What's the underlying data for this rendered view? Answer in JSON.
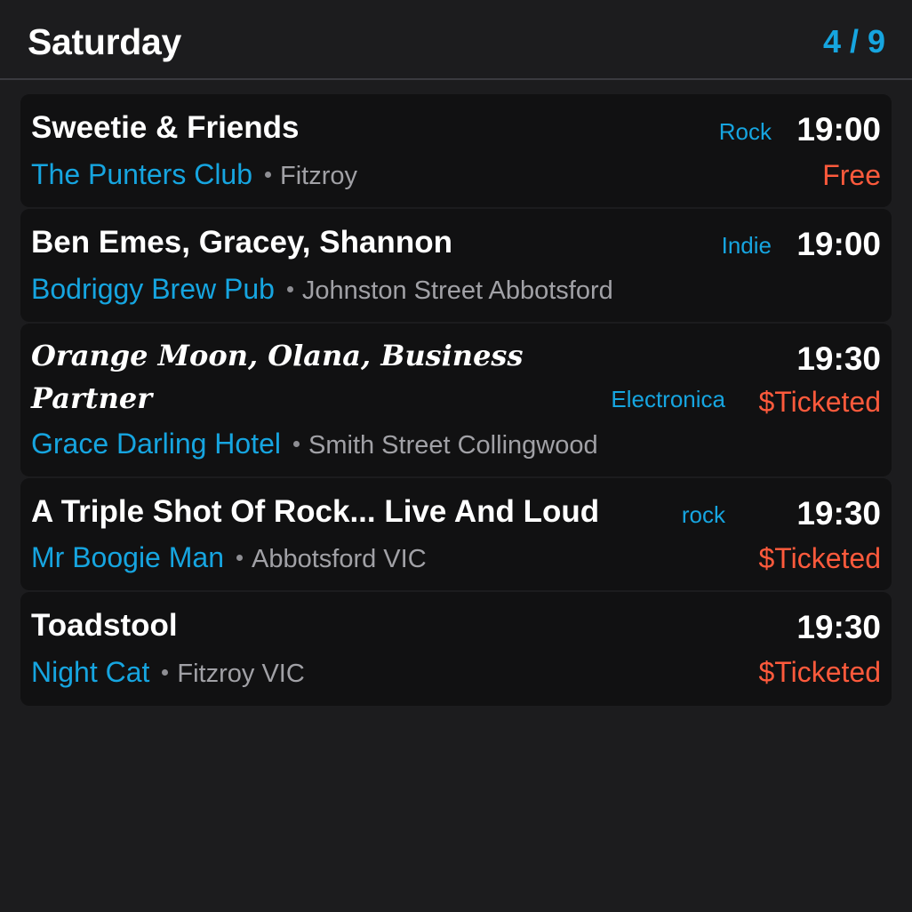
{
  "header": {
    "day": "Saturday",
    "page_counter": "4 / 9"
  },
  "colors": {
    "background": "#1c1c1e",
    "card": "#111112",
    "accent_blue": "#16a5e0",
    "price_orange": "#ff5a3c",
    "text_white": "#ffffff",
    "text_grey": "#a1a1a6"
  },
  "events": [
    {
      "act": "Sweetie & Friends",
      "genre": "Rock",
      "time": "19:00",
      "venue": "The Punters Club",
      "location": "Fitzroy",
      "price": "Free"
    },
    {
      "act": "Ben Emes, Gracey, Shannon",
      "genre": "Indie",
      "time": "19:00",
      "venue": "Bodriggy Brew Pub",
      "location": "Johnston Street Abbotsford",
      "price": ""
    },
    {
      "act": "Orange Moon, Olana, Business Partner",
      "genre": "Electronica",
      "time": "19:30",
      "venue": "Grace Darling Hotel",
      "location": "Smith Street Collingwood",
      "price": "$Ticketed"
    },
    {
      "act": "A Triple Shot Of Rock... Live And Loud",
      "genre": "rock",
      "time": "19:30",
      "venue": "Mr Boogie Man",
      "location": "Abbotsford VIC",
      "price": "$Ticketed"
    },
    {
      "act": "Toadstool",
      "genre": "",
      "time": "19:30",
      "venue": "Night Cat",
      "location": "Fitzroy VIC",
      "price": "$Ticketed"
    }
  ]
}
